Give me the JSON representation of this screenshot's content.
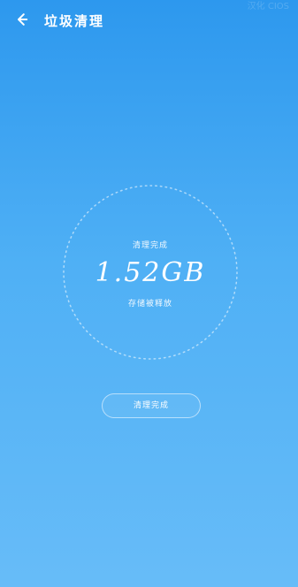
{
  "header": {
    "title": "垃圾清理",
    "back_icon": "arrow-left-icon",
    "watermark": "汉化 CIOS"
  },
  "result": {
    "status_small": "清理完成",
    "size": "1.52GB",
    "released_text": "存储被释放"
  },
  "actions": {
    "done_label": "清理完成"
  },
  "colors": {
    "gradient_top": "#2d98ee",
    "gradient_bottom": "#67bcf8",
    "text": "#ffffff"
  }
}
